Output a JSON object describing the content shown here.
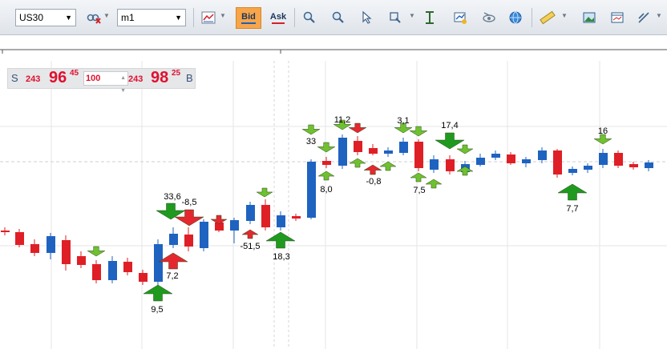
{
  "toolbar": {
    "symbol": "US30",
    "timeframe": "m1",
    "bid_label": "Bid",
    "ask_label": "Ask"
  },
  "quote": {
    "sell_label": "S",
    "sell_big": "243",
    "sell_main": "96",
    "sell_sup": "45",
    "lot": "100",
    "buy_big": "243",
    "buy_main": "98",
    "buy_sup": "25",
    "buy_label": "B"
  },
  "colors": {
    "bull": "#1f63c0",
    "bear": "#df1f26",
    "arrow_up": "#1f9a1f",
    "arrow_down_green": "#6fc12f",
    "arrow_red": "#e5282e",
    "grid": "#e6e6e6"
  },
  "annotations": [
    "33,6",
    "-8,5",
    "7,2",
    "9,5",
    "-51,5",
    "18,3",
    "33",
    "8,0",
    "11,2",
    "-0,8",
    "3,1",
    "7,5",
    "17,4",
    "16",
    "7,7"
  ]
}
